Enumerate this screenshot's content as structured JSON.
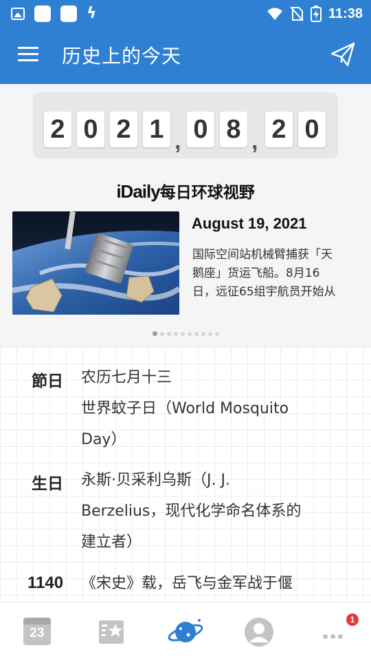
{
  "status_bar": {
    "time": "11:38",
    "left_icons": [
      "image-icon",
      "app-square-icon",
      "app-square-icon",
      "bolt-icon"
    ],
    "right_icons": [
      "wifi-icon",
      "no-sim-icon",
      "battery-charging-icon"
    ]
  },
  "app_bar": {
    "title": "历史上的今天",
    "menu_icon": "hamburger-icon",
    "action_icon": "send-icon"
  },
  "date": {
    "digits": [
      "2",
      "0",
      "2",
      "1",
      "0",
      "8",
      "2",
      "0"
    ],
    "separator": ","
  },
  "carousel": {
    "brand_en": "iDaily",
    "brand_cn": "每日环球视野",
    "date": "August 19, 2021",
    "lines": [
      "国际空间站机械臂捕获「天",
      "鹅座」货运飞船。8月16",
      "日，远征65组宇航员开始从"
    ],
    "page_count": 10,
    "active_page": 1
  },
  "entries": [
    {
      "tag": "節日",
      "lines": [
        "农历七月十三",
        "世界蚊子日（World Mosquito",
        "Day）"
      ]
    },
    {
      "tag": "生日",
      "lines": [
        "永斯·贝采利乌斯（J. J.",
        "Berzelius，现代化学命名体系的",
        "建立者）"
      ]
    },
    {
      "tag": "1140",
      "lines": [
        "《宋史》载，岳飞与金军战于偃"
      ]
    }
  ],
  "bottom_nav": {
    "calendar_label": "23",
    "items": [
      "calendar-icon",
      "favorites-icon",
      "planet-icon",
      "profile-icon",
      "more-icon"
    ],
    "active": "planet-icon",
    "more_badge": "1"
  },
  "colors": {
    "primary": "#2f80d3",
    "panel_bg": "#f5f5f5",
    "badge": "#e53935"
  }
}
